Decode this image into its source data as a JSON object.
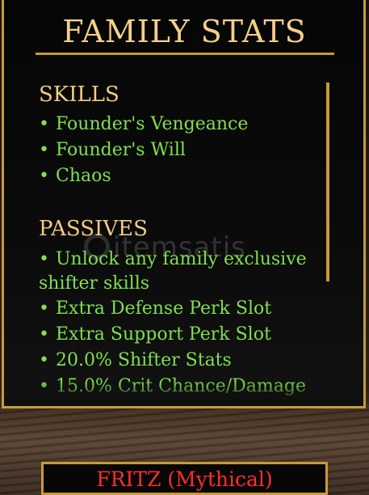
{
  "header": {
    "title": "FAMILY STATS"
  },
  "skills": {
    "heading": "SKILLS",
    "items": [
      "Founder's Vengeance",
      "Founder's Will",
      "Chaos"
    ]
  },
  "passives": {
    "heading": "PASSIVES",
    "items": [
      "Unlock any family exclusive",
      "shifter skills",
      "Extra Defense Perk Slot",
      "Extra Support Perk Slot",
      "20.0% Shifter Stats",
      "15.0% Crit Chance/Damage"
    ]
  },
  "watermark": {
    "text": "itemsatis"
  },
  "family_name": {
    "label": "FRITZ (Mythical)"
  },
  "colors": {
    "gold": "#c79a3c",
    "heading": "#f1cb83",
    "item_text": "#7ee04f",
    "name_text": "#ff2d2d"
  }
}
